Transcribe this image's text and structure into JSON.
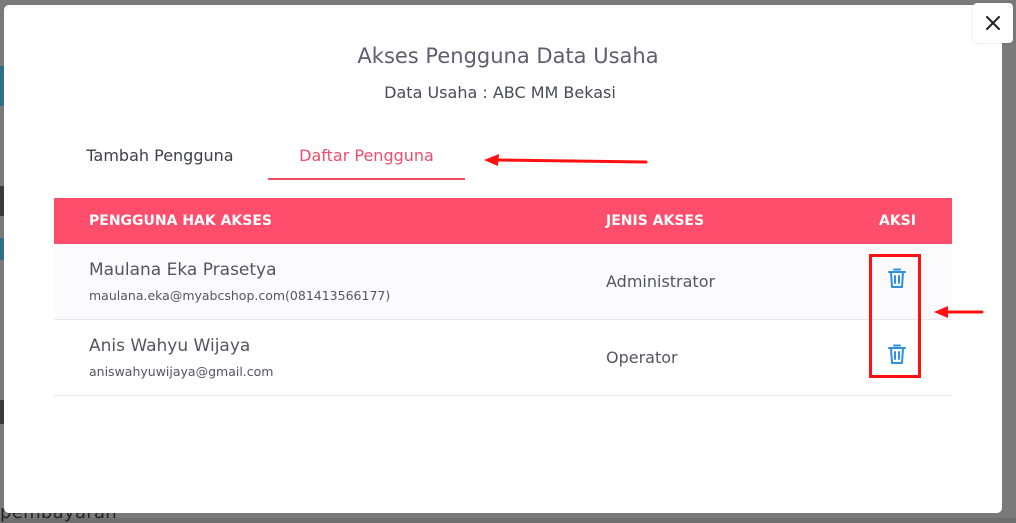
{
  "background": {
    "partial_text": "pembayaran"
  },
  "modal": {
    "title": "Akses Pengguna Data Usaha",
    "subtitle": "Data Usaha : ABC MM Bekasi",
    "tabs": [
      {
        "label": "Tambah Pengguna",
        "active": false
      },
      {
        "label": "Daftar Pengguna",
        "active": true
      }
    ],
    "table": {
      "headers": {
        "user": "PENGGUNA HAK AKSES",
        "type": "JENIS AKSES",
        "action": "AKSI"
      },
      "rows": [
        {
          "name": "Maulana Eka Prasetya",
          "email": "maulana.eka@myabcshop.com(081413566177)",
          "access": "Administrator"
        },
        {
          "name": "Anis Wahyu Wijaya",
          "email": "aniswahyuwijaya@gmail.com",
          "access": "Operator"
        }
      ]
    }
  },
  "icons": {
    "close": "close-icon",
    "delete": "trash-icon"
  },
  "colors": {
    "accent": "#ef4d6c",
    "header_bg": "#ff4e6b",
    "icon_blue": "#2f8fe0",
    "annotation_red": "#ff1111"
  }
}
